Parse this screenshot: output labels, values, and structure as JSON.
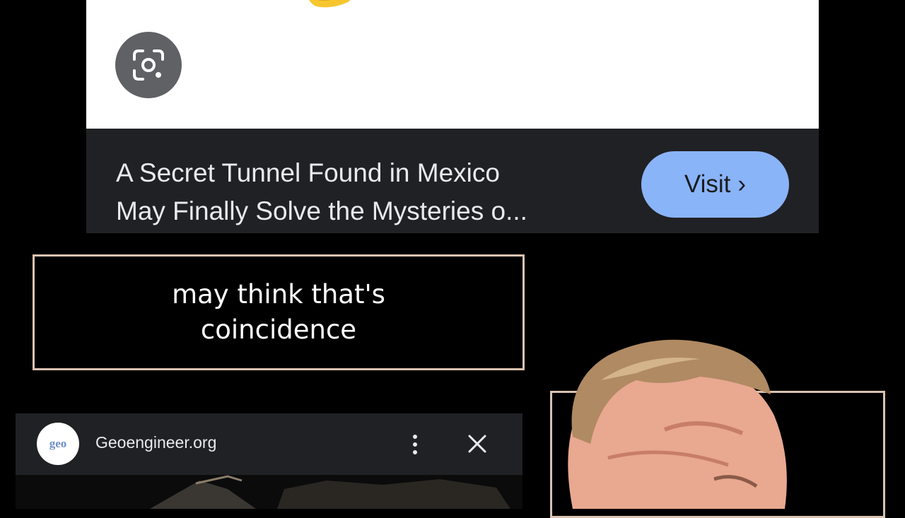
{
  "lens_result": {
    "headline_line1": "A Secret Tunnel Found in Mexico",
    "headline_line2": "May Finally Solve the Mysteries o...",
    "visit_label": "Visit",
    "visit_chevron": "›"
  },
  "caption": {
    "line1": "may think that's",
    "line2": "coincidence"
  },
  "source": {
    "logo_text": "geo",
    "site_name": "Geoengineer.org"
  },
  "colors": {
    "card_footer": "#202124",
    "visit_button": "#8ab4f8",
    "caption_border": "#d9c2b0"
  },
  "icons": [
    "google-lens-icon",
    "more-vert-icon",
    "close-icon"
  ]
}
